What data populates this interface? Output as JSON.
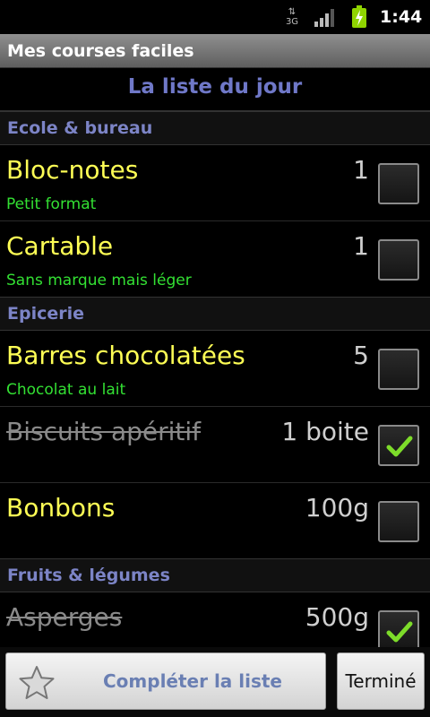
{
  "status_bar": {
    "network": "3G",
    "time": "1:44"
  },
  "app": {
    "title": "Mes courses faciles"
  },
  "list": {
    "title": "La liste du jour"
  },
  "sections": [
    {
      "label": "Ecole & bureau",
      "items": [
        {
          "name": "Bloc-notes",
          "note": "Petit format",
          "qty": "1",
          "checked": false
        },
        {
          "name": "Cartable",
          "note": "Sans marque mais léger",
          "qty": "1",
          "checked": false
        }
      ]
    },
    {
      "label": "Epicerie",
      "items": [
        {
          "name": "Barres chocolatées",
          "note": "Chocolat au lait",
          "qty": "5",
          "checked": false
        },
        {
          "name": "Biscuits apéritif",
          "note": "",
          "qty": "1 boite",
          "checked": true
        },
        {
          "name": "Bonbons",
          "note": "",
          "qty": "100g",
          "checked": false
        }
      ]
    },
    {
      "label": "Fruits & légumes",
      "items": [
        {
          "name": "Asperges",
          "note": "",
          "qty": "500g",
          "checked": true
        }
      ]
    }
  ],
  "bottom": {
    "complete_label": "Compléter la liste",
    "done_label": "Terminé"
  },
  "colors": {
    "section_label": "#7c84c6",
    "item_name": "#ffff55",
    "item_note": "#33e033",
    "checked_item": "#8a8a8a",
    "checkmark": "#7ddc2a"
  }
}
